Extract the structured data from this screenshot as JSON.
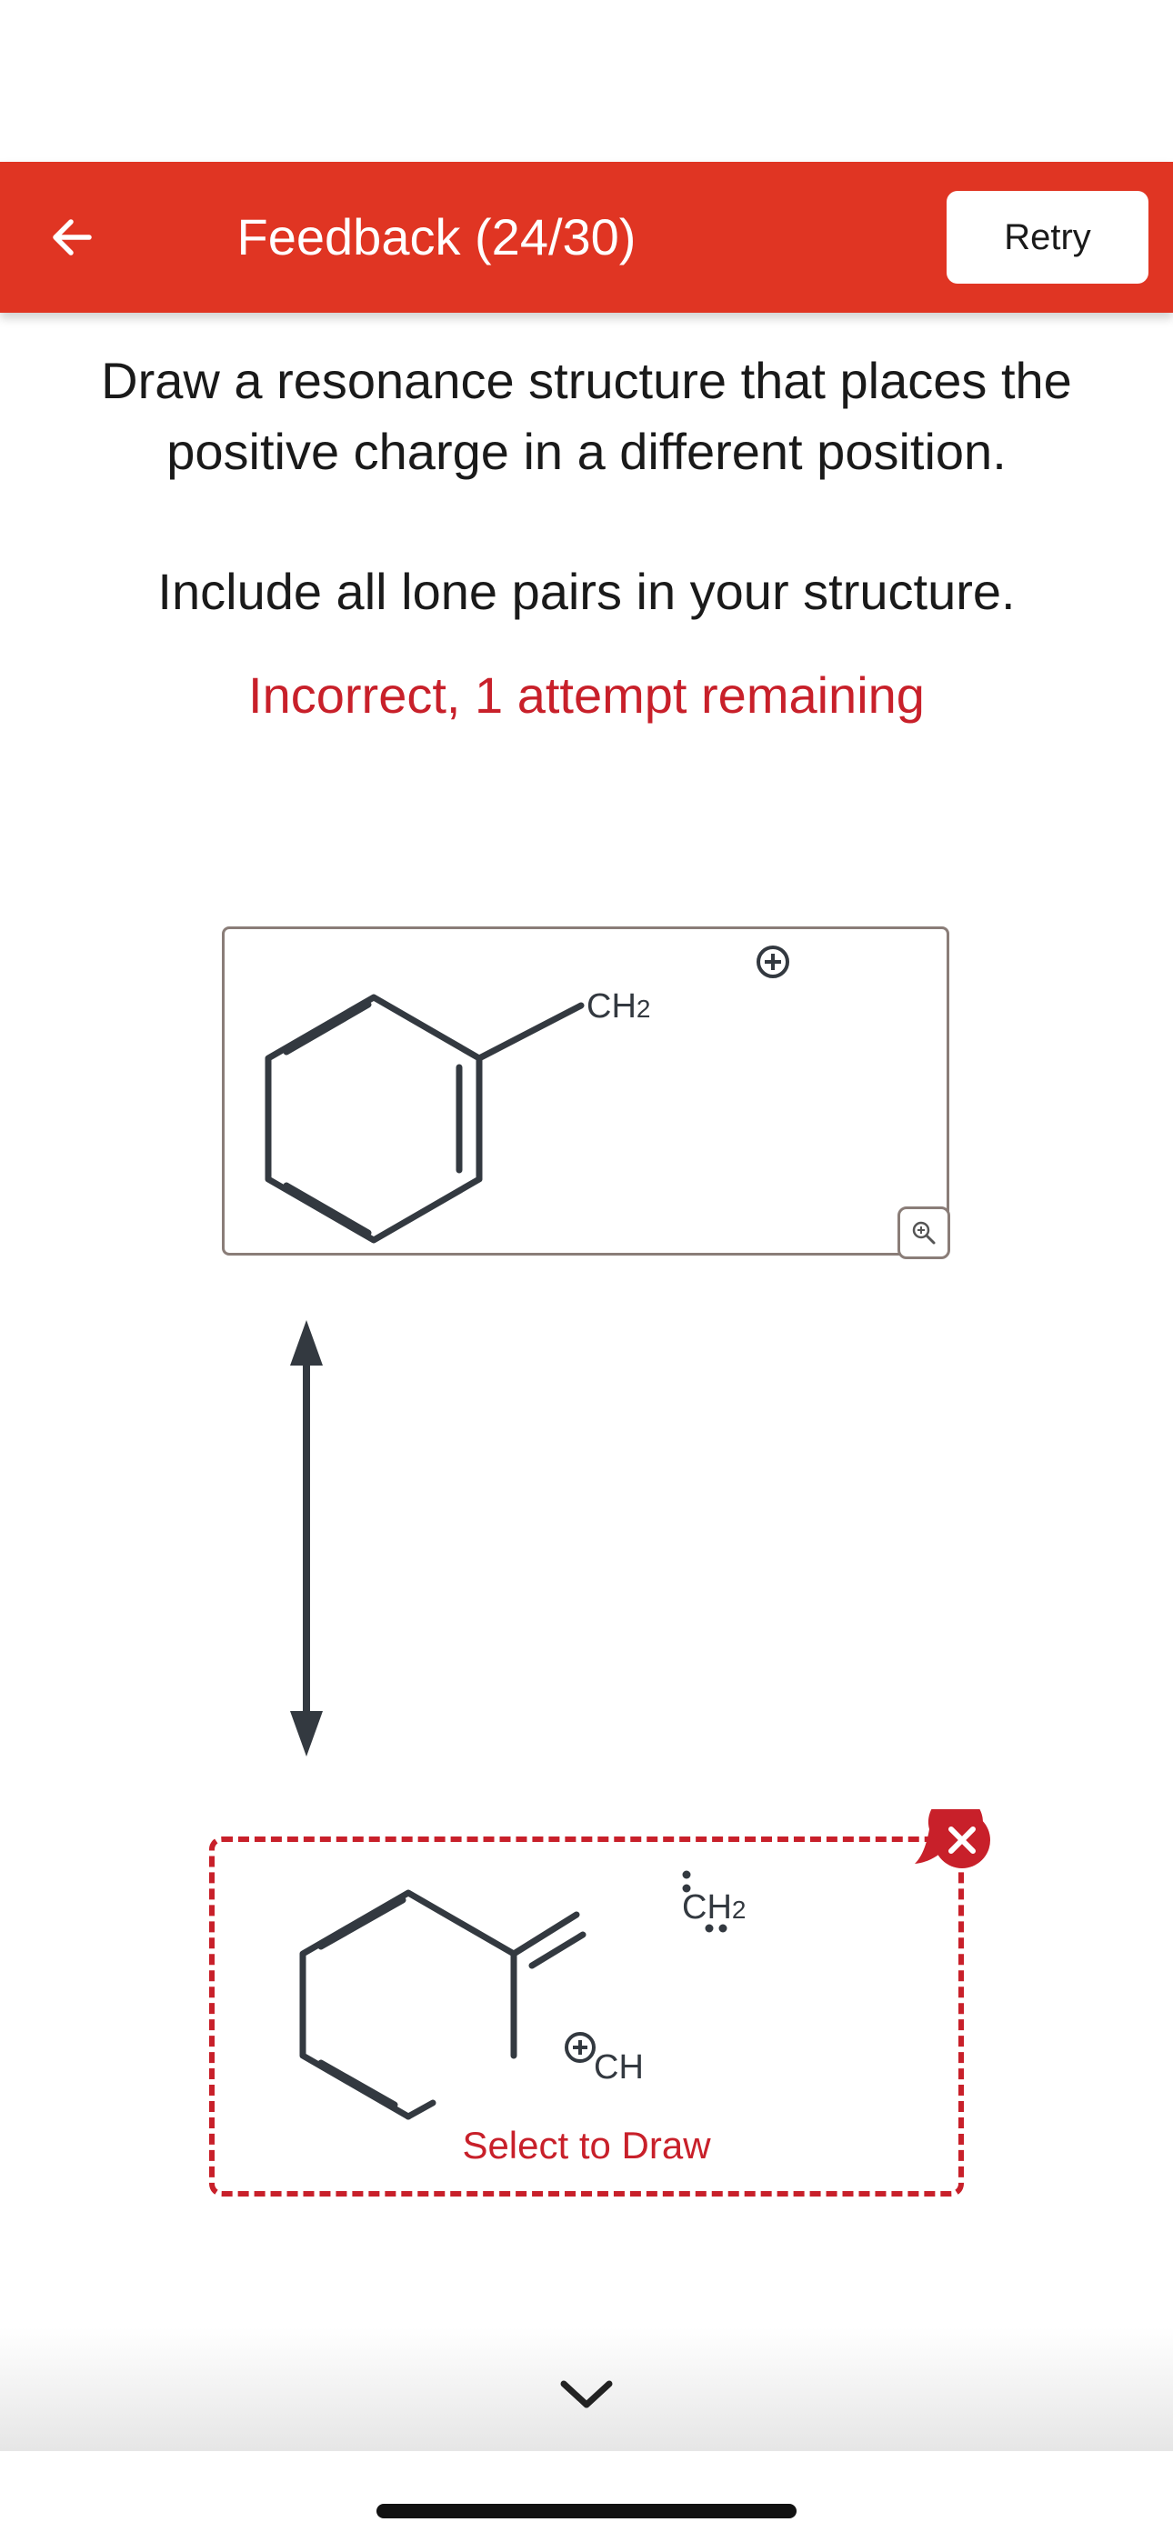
{
  "header": {
    "title": "Feedback (24/30)",
    "retry_label": "Retry",
    "background_color": "#e03523"
  },
  "question": {
    "prompt": "Draw a resonance structure that places the positive charge in a different position.",
    "instruction": "Include all lone pairs in your structure.",
    "feedback": "Incorrect, 1 attempt remaining",
    "feedback_color": "#c8202a"
  },
  "given_structure": {
    "group_label_main": "CH",
    "group_label_sub": "2",
    "charge": "+",
    "zoom_icon": "zoom-in-icon"
  },
  "resonance_arrow": {
    "icon": "double-headed-arrow-icon"
  },
  "answer_structure": {
    "group_label_main": "CH",
    "group_label_sub": "2",
    "ring_group_label": "CH",
    "charge": "+",
    "select_label": "Select to Draw",
    "incorrect_icon": "close-icon"
  },
  "footer": {
    "expand_icon": "chevron-down-icon"
  }
}
